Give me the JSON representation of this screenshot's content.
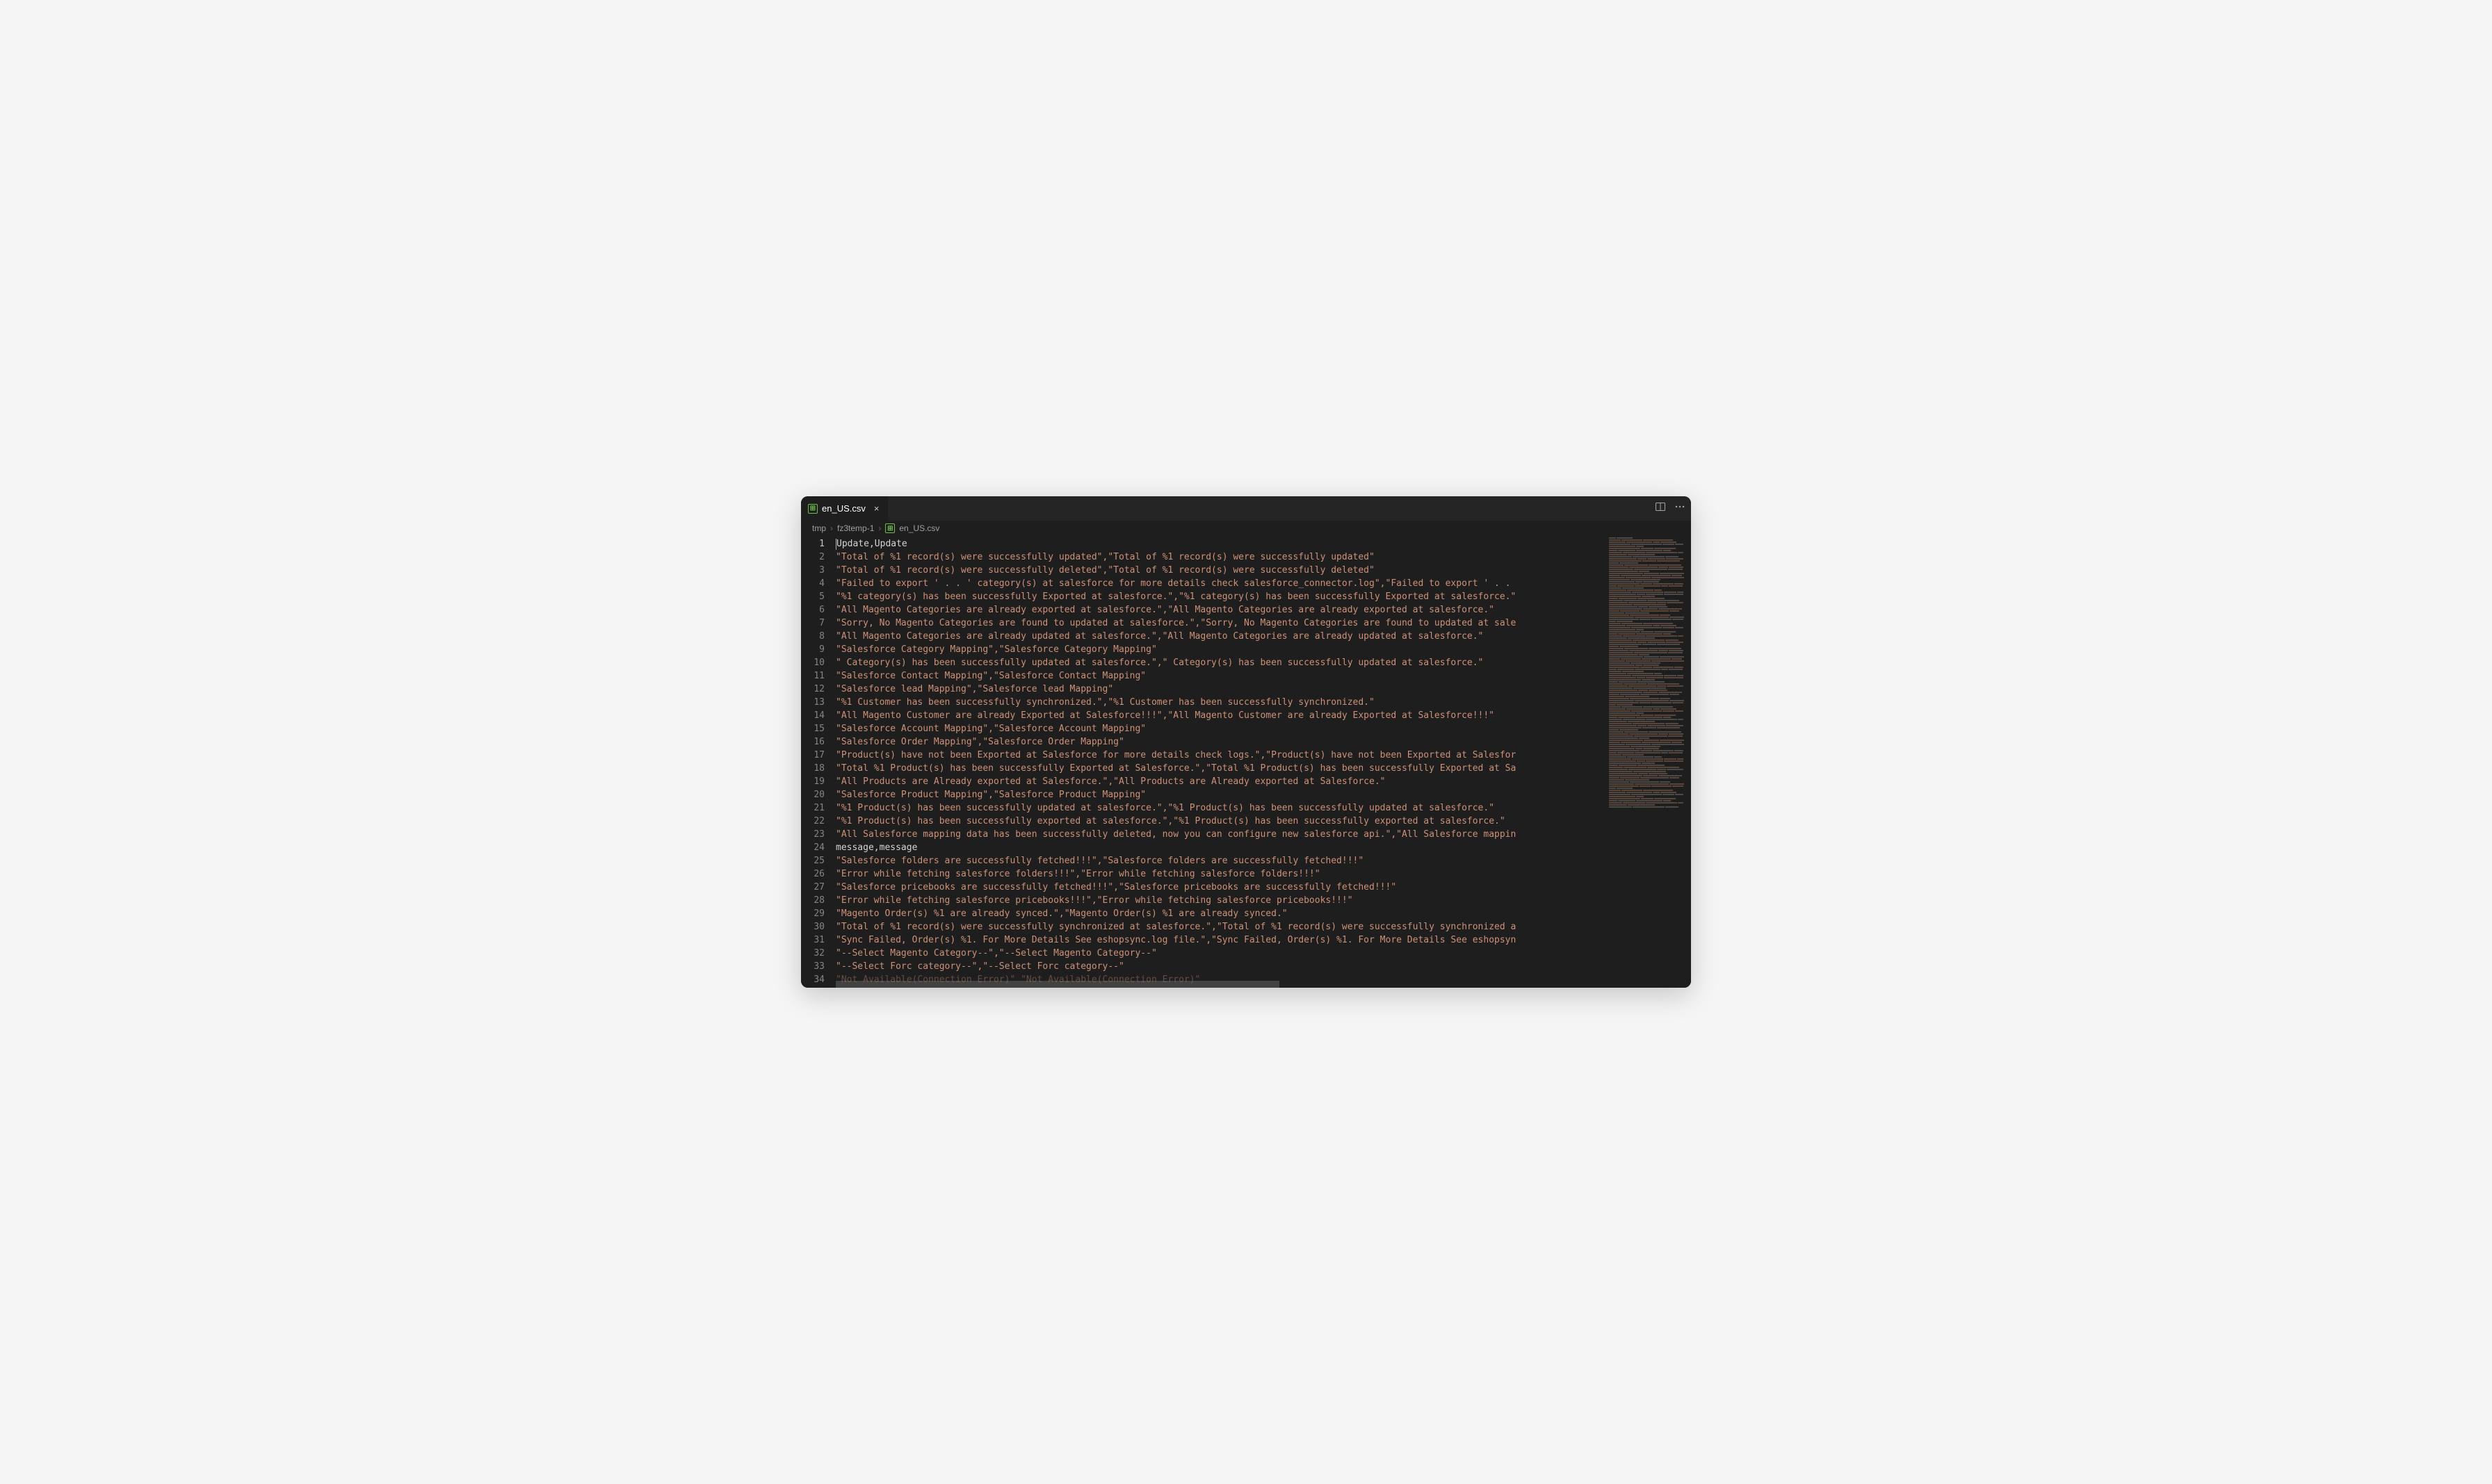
{
  "tab": {
    "filename": "en_US.csv",
    "icon_label": "⊞"
  },
  "breadcrumb": {
    "parts": [
      "tmp",
      "fz3temp-1"
    ],
    "file": "en_US.csv"
  },
  "code": {
    "lines": [
      {
        "n": 1,
        "text": "Update,Update",
        "quoted": false
      },
      {
        "n": 2,
        "text": "\"Total of %1 record(s) were successfully updated\",\"Total of %1 record(s) were successfully updated\"",
        "quoted": true
      },
      {
        "n": 3,
        "text": "\"Total of %1 record(s) were successfully deleted\",\"Total of %1 record(s) were successfully deleted\"",
        "quoted": true
      },
      {
        "n": 4,
        "text": "\"Failed to export ' . . ' category(s) at salesforce for more details check salesforce_connector.log\",\"Failed to export ' . .",
        "quoted": true
      },
      {
        "n": 5,
        "text": "\"%1 category(s) has been successfully Exported at salesforce.\",\"%1 category(s) has been successfully Exported at salesforce.\"",
        "quoted": true
      },
      {
        "n": 6,
        "text": "\"All Magento Categories are already exported at salesforce.\",\"All Magento Categories are already exported at salesforce.\"",
        "quoted": true
      },
      {
        "n": 7,
        "text": "\"Sorry, No Magento Categories are found to updated at salesforce.\",\"Sorry, No Magento Categories are found to updated at sale",
        "quoted": true
      },
      {
        "n": 8,
        "text": "\"All Magento Categories are already updated at salesforce.\",\"All Magento Categories are already updated at salesforce.\"",
        "quoted": true
      },
      {
        "n": 9,
        "text": "\"Salesforce Category Mapping\",\"Salesforce Category Mapping\"",
        "quoted": true
      },
      {
        "n": 10,
        "text": "\" Category(s) has been successfully updated at salesforce.\",\" Category(s) has been successfully updated at salesforce.\"",
        "quoted": true
      },
      {
        "n": 11,
        "text": "\"Salesforce Contact Mapping\",\"Salesforce Contact Mapping\"",
        "quoted": true
      },
      {
        "n": 12,
        "text": "\"Salesforce lead Mapping\",\"Salesforce lead Mapping\"",
        "quoted": true
      },
      {
        "n": 13,
        "text": "\"%1 Customer has been successfully synchronized.\",\"%1 Customer has been successfully synchronized.\"",
        "quoted": true
      },
      {
        "n": 14,
        "text": "\"All Magento Customer are already Exported at Salesforce!!!\",\"All Magento Customer are already Exported at Salesforce!!!\"",
        "quoted": true
      },
      {
        "n": 15,
        "text": "\"Salesforce Account Mapping\",\"Salesforce Account Mapping\"",
        "quoted": true
      },
      {
        "n": 16,
        "text": "\"Salesforce Order Mapping\",\"Salesforce Order Mapping\"",
        "quoted": true
      },
      {
        "n": 17,
        "text": "\"Product(s) have not been Exported at Salesforce for more details check logs.\",\"Product(s) have not been Exported at Salesfor",
        "quoted": true
      },
      {
        "n": 18,
        "text": "\"Total %1 Product(s) has been successfully Exported at Salesforce.\",\"Total %1 Product(s) has been successfully Exported at Sa",
        "quoted": true
      },
      {
        "n": 19,
        "text": "\"All Products are Already exported at Salesforce.\",\"All Products are Already exported at Salesforce.\"",
        "quoted": true
      },
      {
        "n": 20,
        "text": "\"Salesforce Product Mapping\",\"Salesforce Product Mapping\"",
        "quoted": true
      },
      {
        "n": 21,
        "text": "\"%1 Product(s) has been successfully updated at salesforce.\",\"%1 Product(s) has been successfully updated at salesforce.\"",
        "quoted": true
      },
      {
        "n": 22,
        "text": "\"%1 Product(s) has been successfully exported at salesforce.\",\"%1 Product(s) has been successfully exported at salesforce.\"",
        "quoted": true
      },
      {
        "n": 23,
        "text": "\"All Salesforce mapping data has been successfully deleted, now you can configure new salesforce api.\",\"All Salesforce mappin",
        "quoted": true
      },
      {
        "n": 24,
        "text": "message,message",
        "quoted": false
      },
      {
        "n": 25,
        "text": "\"Salesforce folders are successfully fetched!!!\",\"Salesforce folders are successfully fetched!!!\"",
        "quoted": true
      },
      {
        "n": 26,
        "text": "\"Error while fetching salesforce folders!!!\",\"Error while fetching salesforce folders!!!\"",
        "quoted": true
      },
      {
        "n": 27,
        "text": "\"Salesforce pricebooks are successfully fetched!!!\",\"Salesforce pricebooks are successfully fetched!!!\"",
        "quoted": true
      },
      {
        "n": 28,
        "text": "\"Error while fetching salesforce pricebooks!!!\",\"Error while fetching salesforce pricebooks!!!\"",
        "quoted": true
      },
      {
        "n": 29,
        "text": "\"Magento Order(s) %1 are already synced.\",\"Magento Order(s) %1 are already synced.\"",
        "quoted": true
      },
      {
        "n": 30,
        "text": "\"Total of %1 record(s) were successfully synchronized at salesforce.\",\"Total of %1 record(s) were successfully synchronized a",
        "quoted": true
      },
      {
        "n": 31,
        "text": "\"Sync Failed, Order(s) %1. For More Details See eshopsync.log file.\",\"Sync Failed, Order(s) %1. For More Details See eshopsyn",
        "quoted": true
      },
      {
        "n": 32,
        "text": "\"--Select Magento Category--\",\"--Select Magento Category--\"",
        "quoted": true
      },
      {
        "n": 33,
        "text": "\"--Select Forc category--\",\"--Select Forc category--\"",
        "quoted": true
      },
      {
        "n": 34,
        "text": "\"Not Available(Connection Error)\" \"Not Available(Connection Error)\"",
        "quoted": true,
        "dim": true
      }
    ]
  }
}
